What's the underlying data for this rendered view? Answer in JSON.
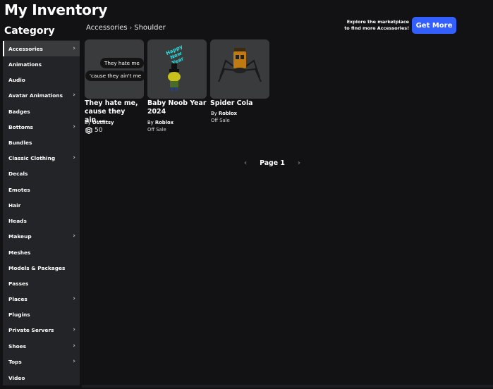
{
  "page": {
    "title": "My Inventory"
  },
  "sidebar": {
    "heading": "Category",
    "items": [
      {
        "label": "Accessories",
        "has_chevron": true,
        "active": true
      },
      {
        "label": "Animations",
        "has_chevron": false
      },
      {
        "label": "Audio",
        "has_chevron": false
      },
      {
        "label": "Avatar Animations",
        "has_chevron": true
      },
      {
        "label": "Badges",
        "has_chevron": false
      },
      {
        "label": "Bottoms",
        "has_chevron": true
      },
      {
        "label": "Bundles",
        "has_chevron": false
      },
      {
        "label": "Classic Clothing",
        "has_chevron": true
      },
      {
        "label": "Decals",
        "has_chevron": false
      },
      {
        "label": "Emotes",
        "has_chevron": false
      },
      {
        "label": "Hair",
        "has_chevron": false
      },
      {
        "label": "Heads",
        "has_chevron": false
      },
      {
        "label": "Makeup",
        "has_chevron": true
      },
      {
        "label": "Meshes",
        "has_chevron": false
      },
      {
        "label": "Models & Packages",
        "has_chevron": false
      },
      {
        "label": "Passes",
        "has_chevron": false
      },
      {
        "label": "Places",
        "has_chevron": true
      },
      {
        "label": "Plugins",
        "has_chevron": false
      },
      {
        "label": "Private Servers",
        "has_chevron": true
      },
      {
        "label": "Shoes",
        "has_chevron": true
      },
      {
        "label": "Tops",
        "has_chevron": true
      },
      {
        "label": "Video",
        "has_chevron": false
      }
    ]
  },
  "breadcrumb": {
    "items": [
      "Accessories",
      "Shoulder"
    ]
  },
  "promo": {
    "text_line1": "Explore the marketplace",
    "text_line2": "to find more Accessories!",
    "button_label": "Get More",
    "button_color": "#335fff"
  },
  "items": [
    {
      "name": "They hate me, cause they ain...",
      "creator_prefix": "By",
      "creator": "Outfitsy",
      "price": "50",
      "price_icon": "robux-icon",
      "thumb_text1": "They hate me",
      "thumb_text2": "'cause they ain't me"
    },
    {
      "name": "Baby Noob Year 2024",
      "creator_prefix": "By",
      "creator": "Roblox",
      "status": "Off Sale",
      "thumb_text": "Happy New Year"
    },
    {
      "name": "Spider Cola",
      "creator_prefix": "By",
      "creator": "Roblox",
      "status": "Off Sale"
    }
  ],
  "pagination": {
    "label": "Page 1",
    "prev_icon": "chevron-left-icon",
    "next_icon": "chevron-right-icon"
  }
}
